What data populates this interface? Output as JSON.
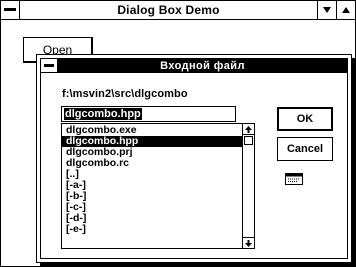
{
  "main_window": {
    "title": "Dialog Box Demo",
    "open_button_label": "Open"
  },
  "dialog": {
    "title": "Входной файл",
    "directory": "f:\\msvin2\\src\\dlgcombo",
    "filename_value": "dlgcombo.hpp",
    "ok_label": "OK",
    "cancel_label": "Cancel",
    "selected_index": 1,
    "files": [
      "dlgcombo.exe",
      "dlgcombo.hpp",
      "dlgcombo.prj",
      "dlgcombo.rc",
      "[..]",
      "[-a-]",
      "[-b-]",
      "[-c-]",
      "[-d-]",
      "[-e-]"
    ]
  },
  "icons": {
    "system_menu": "system-menu-icon",
    "minimize": "minimize-arrow-icon",
    "maximize": "maximize-arrow-icon",
    "scroll_up": "scroll-up-arrow-icon",
    "scroll_down": "scroll-down-arrow-icon",
    "file": "file-icon"
  }
}
